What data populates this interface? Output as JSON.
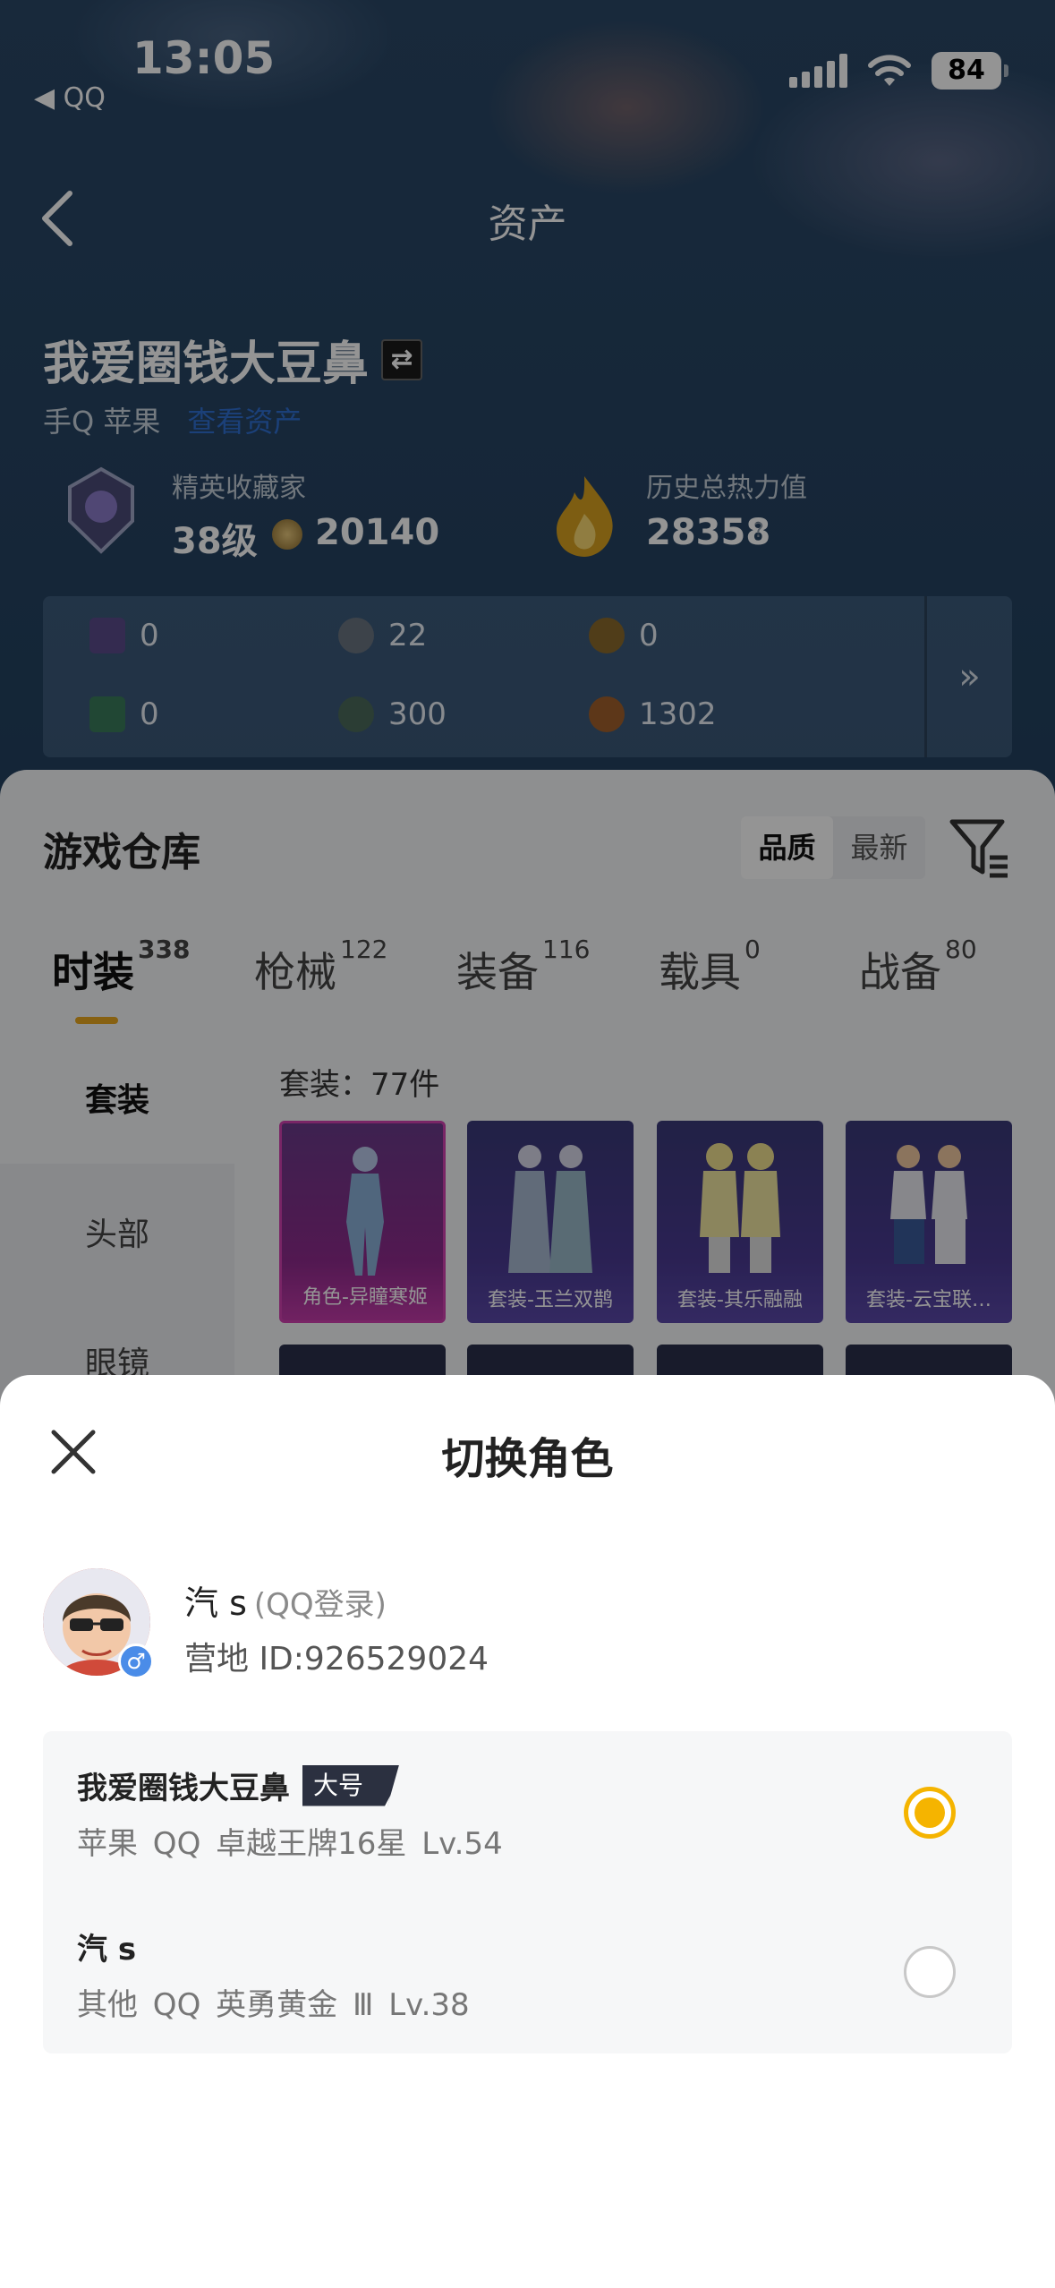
{
  "status_bar": {
    "time": "13:05",
    "back_app": "◀ QQ",
    "battery": "84"
  },
  "header": {
    "title": "资产"
  },
  "player": {
    "name": "我爱圈钱大豆鼻",
    "platform": "手Q 苹果",
    "platform_link": "查看资产",
    "collector_label": "精英收藏家",
    "collector_level": "38级",
    "collector_points": "20140",
    "heat_label": "历史总热力值",
    "heat_value": "28358",
    "help": "?"
  },
  "currencies": {
    "row1": [
      {
        "value": "0",
        "color": "#5a4a8a"
      },
      {
        "value": "22",
        "color": "#6a7480"
      },
      {
        "value": "0",
        "color": "#8a6a2c"
      }
    ],
    "row2": [
      {
        "value": "0",
        "color": "#3a7a5a"
      },
      {
        "value": "300",
        "color": "#4a6a5a"
      },
      {
        "value": "1302",
        "color": "#a0602c"
      }
    ],
    "more": "»"
  },
  "warehouse": {
    "title": "游戏仓库",
    "sort_quality": "品质",
    "sort_latest": "最新",
    "tabs": [
      {
        "label": "时装",
        "count": "338"
      },
      {
        "label": "枪械",
        "count": "122"
      },
      {
        "label": "装备",
        "count": "116"
      },
      {
        "label": "载具",
        "count": "0"
      },
      {
        "label": "战备",
        "count": "80"
      }
    ],
    "side": [
      "套装",
      "头部",
      "眼镜"
    ],
    "set_count": "套装：77件",
    "cards": [
      "角色-异瞳寒姬",
      "套装-玉兰双鹊",
      "套装-其乐融融",
      "套装-云宝联…"
    ]
  },
  "sheet": {
    "title": "切换角色",
    "account_name": "汽 s",
    "account_login": "(QQ登录)",
    "account_id": "营地 ID:926529024",
    "roles": [
      {
        "name": "我爱圈钱大豆鼻",
        "badge": "大号",
        "meta": "苹果 QQ   卓越王牌16星   Lv.54",
        "selected": true
      },
      {
        "name": "汽 s",
        "badge": "",
        "meta": "其他 QQ   英勇黄金 Ⅲ   Lv.38",
        "selected": false
      }
    ]
  },
  "colors": {
    "accent": "#f5b400",
    "tab_underline": "#e8a820",
    "link": "#2f6fd0"
  }
}
